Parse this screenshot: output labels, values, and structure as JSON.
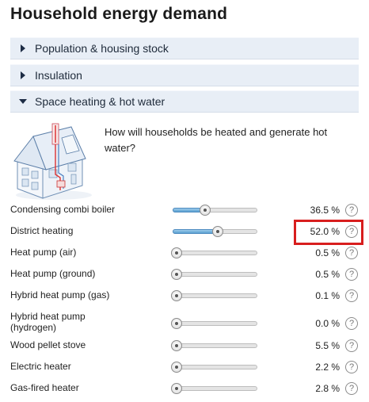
{
  "page_title": "Household energy demand",
  "sections": [
    {
      "label": "Population & housing stock",
      "expanded": false
    },
    {
      "label": "Insulation",
      "expanded": false
    },
    {
      "label": "Space heating & hot water",
      "expanded": true
    }
  ],
  "question": "How will households be heated and generate hot water?",
  "help_glyph": "?",
  "rows": [
    {
      "label": "Condensing combi boiler",
      "value": "36.5 %",
      "level": 0.37
    },
    {
      "label": "District heating",
      "value": "52.0 %",
      "level": 0.52
    },
    {
      "label": "Heat pump (air)",
      "value": "0.5 %",
      "level": 0.0
    },
    {
      "label": "Heat pump (ground)",
      "value": "0.5 %",
      "level": 0.0
    },
    {
      "label": "Hybrid heat pump (gas)",
      "value": "0.1 %",
      "level": 0.0
    },
    {
      "label": "Hybrid heat pump (hydrogen)",
      "value": "0.0 %",
      "level": 0.0
    },
    {
      "label": "Wood pellet stove",
      "value": "5.5 %",
      "level": 0.04
    },
    {
      "label": "Electric heater",
      "value": "2.2 %",
      "level": 0.02
    },
    {
      "label": "Gas-fired heater",
      "value": "2.8 %",
      "level": 0.02
    }
  ],
  "colors": {
    "accordion_bg": "#e8eef6",
    "slider_fill": "#5a9fd0",
    "highlight": "#d81e1e"
  }
}
